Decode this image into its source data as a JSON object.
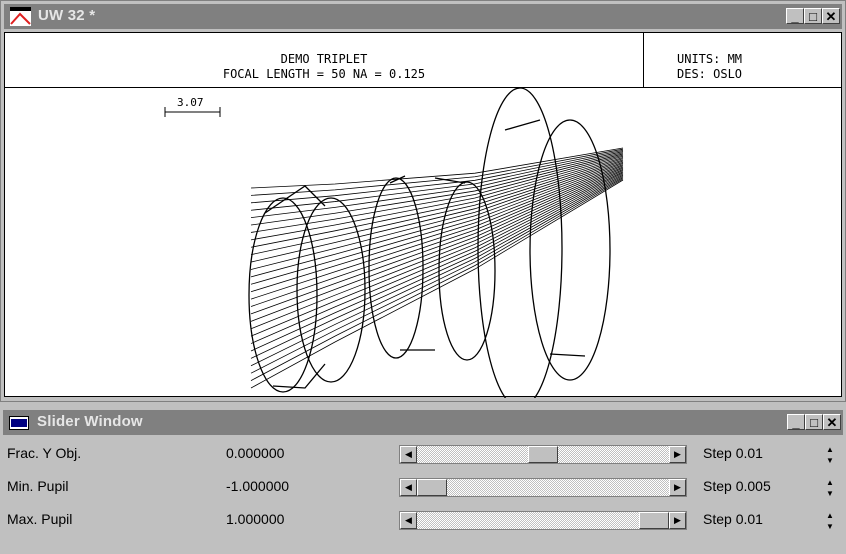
{
  "uw_window": {
    "title": "UW 32 *",
    "buttons": {
      "minimize": "_",
      "maximize": "□",
      "close": "✕"
    },
    "header": {
      "line1": "DEMO TRIPLET",
      "line2": "FOCAL LENGTH = 50   NA = 0.125",
      "units": "UNITS: MM",
      "designer": "DES: OSLO"
    },
    "scale_label": "3.07"
  },
  "slider_window": {
    "title": "Slider Window",
    "buttons": {
      "minimize": "_",
      "maximize": "□",
      "close": "✕"
    },
    "rows": [
      {
        "label": "Frac. Y Obj.",
        "value": "0.000000",
        "step": "Step 0.01",
        "position": 0.5
      },
      {
        "label": "Min. Pupil",
        "value": "-1.000000",
        "step": "Step 0.005",
        "position": 0.0
      },
      {
        "label": "Max. Pupil",
        "value": "1.000000",
        "step": "Step 0.01",
        "position": 1.0
      }
    ]
  }
}
